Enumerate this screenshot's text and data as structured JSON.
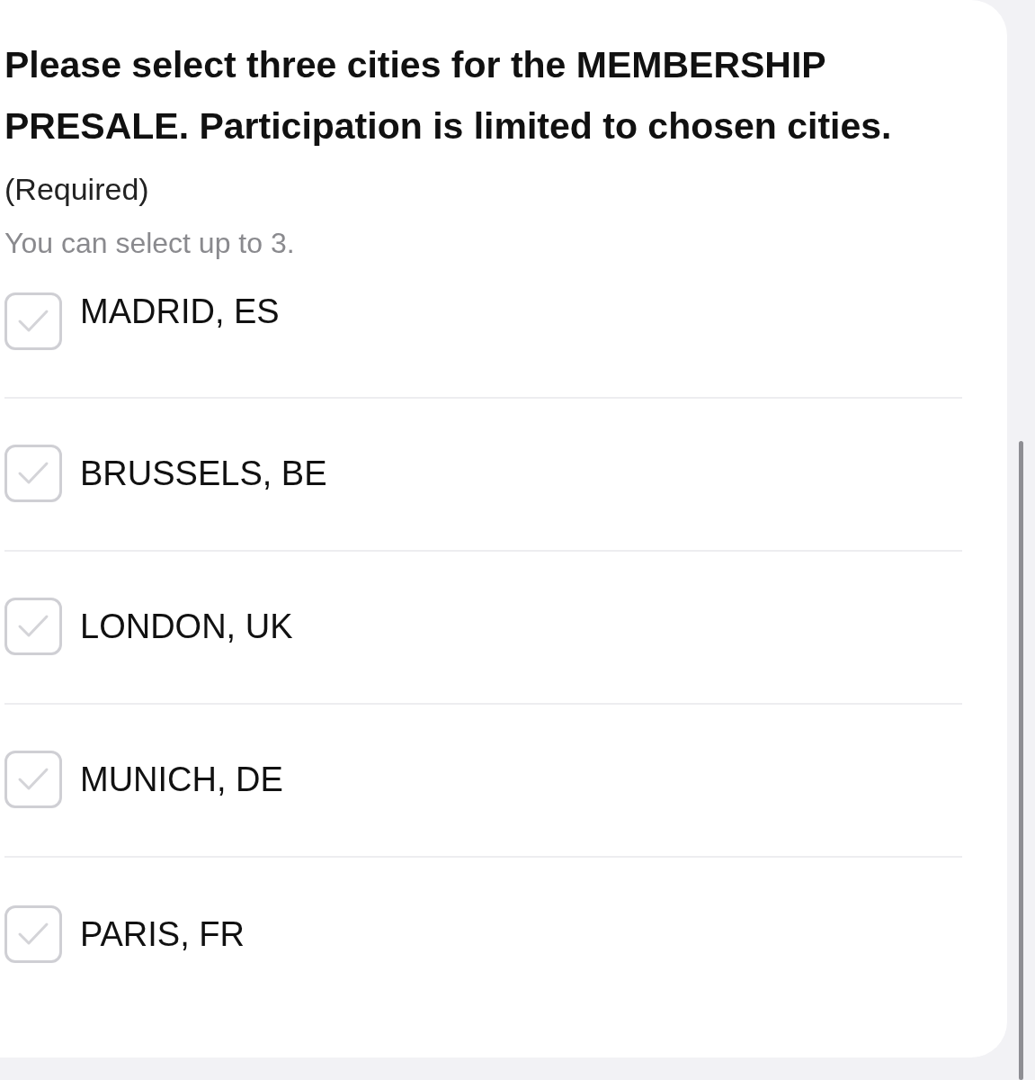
{
  "question": {
    "text": "Please select three cities for the MEMBERSHIP PRESALE. Participation is limited to chosen cities.",
    "required": "(Required)",
    "hint": "You can select up to 3."
  },
  "options": [
    {
      "label": "MADRID, ES",
      "checked": false
    },
    {
      "label": "BRUSSELS, BE",
      "checked": false
    },
    {
      "label": "LONDON, UK",
      "checked": false
    },
    {
      "label": "MUNICH, DE",
      "checked": false
    },
    {
      "label": "PARIS, FR",
      "checked": false
    }
  ]
}
